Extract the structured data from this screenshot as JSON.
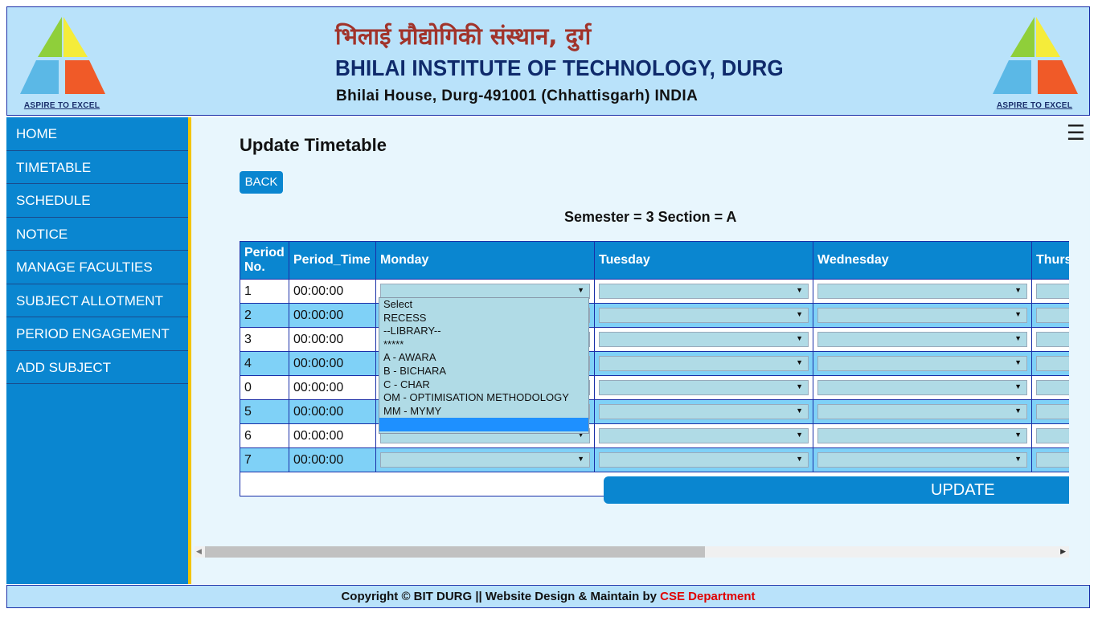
{
  "header": {
    "title_hindi": "भिलाई प्रौद्योगिकी संस्थान, दुर्ग",
    "title_english": "BHILAI INSTITUTE OF TECHNOLOGY, DURG",
    "address": "Bhilai House, Durg-491001 (Chhattisgarh) INDIA",
    "logo_caption": "ASPIRE TO EXCEL"
  },
  "sidebar": {
    "items": [
      {
        "label": "HOME"
      },
      {
        "label": "TIMETABLE"
      },
      {
        "label": "SCHEDULE"
      },
      {
        "label": "NOTICE"
      },
      {
        "label": "MANAGE FACULTIES"
      },
      {
        "label": "SUBJECT ALLOTMENT"
      },
      {
        "label": "PERIOD ENGAGEMENT"
      },
      {
        "label": "ADD SUBJECT"
      }
    ]
  },
  "main": {
    "menu_icon": "hamburger-icon",
    "title": "Update Timetable",
    "back_label": "BACK",
    "semester_info": "Semester = 3 Section = A",
    "update_label": "UPDATE"
  },
  "table": {
    "headers": [
      "Period No.",
      "Period_Time",
      "Monday",
      "Tuesday",
      "Wednesday",
      "Thurs"
    ],
    "rows": [
      {
        "period": "1",
        "time": "00:00:00"
      },
      {
        "period": "2",
        "time": "00:00:00"
      },
      {
        "period": "3",
        "time": "00:00:00"
      },
      {
        "period": "4",
        "time": "00:00:00"
      },
      {
        "period": "0",
        "time": "00:00:00"
      },
      {
        "period": "5",
        "time": "00:00:00"
      },
      {
        "period": "6",
        "time": "00:00:00"
      },
      {
        "period": "7",
        "time": "00:00:00"
      }
    ]
  },
  "dropdown": {
    "options": [
      "Select",
      "RECESS",
      "--LIBRARY--",
      "*****",
      "A - AWARA",
      "B - BICHARA",
      "C - CHAR",
      "OM - OPTIMISATION METHODOLOGY",
      "MM - MYMY",
      ""
    ]
  },
  "footer": {
    "text": "Copyright © BIT DURG || Website Design & Maintain by ",
    "highlight": "CSE Department"
  },
  "colors": {
    "primary": "#0a86d0",
    "header_bg": "#b9e2fa",
    "accent_bar": "#f2c400",
    "row_alt": "#7fd1f7",
    "footer_highlight": "#e00000"
  }
}
